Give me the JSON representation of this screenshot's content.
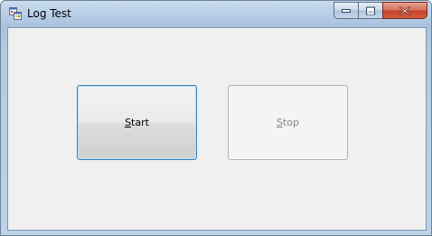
{
  "window": {
    "title": "Log Test",
    "app_icon": "winforms-app-icon",
    "caption_buttons": {
      "minimize_icon": "minimize-icon",
      "maximize_icon": "maximize-icon",
      "close_icon": "close-icon"
    }
  },
  "buttons": {
    "start": {
      "label_mnemonic": "S",
      "label_rest": "tart",
      "enabled": true,
      "focused": true
    },
    "stop": {
      "label_mnemonic": "S",
      "label_rest": "top",
      "enabled": false
    }
  },
  "colors": {
    "client_background": "#f0f0f0",
    "close_button": "#c3432a",
    "focus_border": "#3c7fb1",
    "disabled_text": "#838383"
  }
}
